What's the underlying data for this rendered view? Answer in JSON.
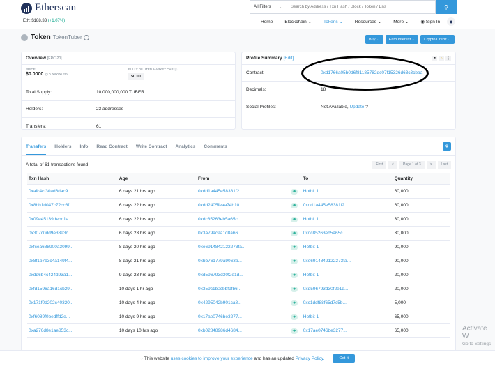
{
  "header": {
    "logo_text": "Etherscan",
    "eth_price_label": "Eth: $188.33",
    "eth_price_change": "(+1.07%)",
    "filter_label": "All Filters",
    "search_placeholder": "Search by Address / Txn Hash / Block / Token / Ens",
    "nav": [
      "Home",
      "Blockchain",
      "Tokens",
      "Resources",
      "More",
      "Sign In"
    ]
  },
  "page": {
    "title": "Token",
    "subtitle": "TokenTuber",
    "buttons": [
      "Buy",
      "Earn Interest",
      "Crypto Credit"
    ]
  },
  "overview": {
    "title": "Overview",
    "tag": "[ERC-20]",
    "price_label": "PRICE",
    "price_value": "$0.0000",
    "price_eth": "@ 0.000000 Eth",
    "cap_label": "FULLY DILUTED MARKET CAP",
    "cap_value": "$0.00",
    "rows": [
      {
        "label": "Total Supply:",
        "value": "10,000,000,000 TUBER"
      },
      {
        "label": "Holders:",
        "value": "23 addresses"
      },
      {
        "label": "Transfers:",
        "value": "61"
      }
    ]
  },
  "profile": {
    "title": "Profile Summary",
    "edit": "[Edit]",
    "contract_label": "Contract:",
    "contract_value": "0xd1766a05b0d6f81185782dc07f15326d63c3cbaa",
    "decimals_label": "Decimals:",
    "decimals_value": "18",
    "social_label": "Social Profiles:",
    "social_value": "Not Available,",
    "social_update": "Update",
    "social_q": "?"
  },
  "tabs": [
    "Transfers",
    "Holders",
    "Info",
    "Read Contract",
    "Write Contract",
    "Analytics",
    "Comments"
  ],
  "transfers": {
    "total": "A total of 61 transactions found",
    "pager": [
      "First",
      "<",
      "Page 1 of 3",
      ">",
      "Last"
    ],
    "columns": [
      "Txn Hash",
      "Age",
      "From",
      "",
      "To",
      "Quantity"
    ],
    "rows": [
      {
        "hash": "0xafc4cf30ad6dac9...",
        "age": "6 days 21 hrs ago",
        "from": "0xdd1a445e58381f2...",
        "to": "Hotbit 1",
        "qty": "60,000"
      },
      {
        "hash": "0x8bb1d047c72cc8f...",
        "age": "6 days 22 hrs ago",
        "from": "0xdd2405feaa74b10...",
        "to": "0xdd1a445e58381f2...",
        "qty": "60,000"
      },
      {
        "hash": "0x09e45139debc1a...",
        "age": "6 days 22 hrs ago",
        "from": "0xdc85263eb5a65c...",
        "to": "Hotbit 1",
        "qty": "30,000"
      },
      {
        "hash": "0x307c0dd9e3393c...",
        "age": "6 days 23 hrs ago",
        "from": "0x3a79ac9a1d8a66...",
        "to": "0xdc85263eb5a65c...",
        "qty": "30,000"
      },
      {
        "hash": "0xfcea688900a3099...",
        "age": "8 days 20 hrs ago",
        "from": "0xe6914842122273fa...",
        "to": "Hotbit 1",
        "qty": "90,000"
      },
      {
        "hash": "0x8f1b7b3c4a149f4...",
        "age": "8 days 21 hrs ago",
        "from": "0xbb761779a9063b...",
        "to": "0xe6914842122273fa...",
        "qty": "90,000"
      },
      {
        "hash": "0xdd6b4c424d93a1...",
        "age": "9 days 23 hrs ago",
        "from": "0xd596793d30f2e1d...",
        "to": "Hotbit 1",
        "qty": "20,000"
      },
      {
        "hash": "0xfd1596a16d1cb29...",
        "age": "10 days 1 hr ago",
        "from": "0x359c1b0cbbf9fb6...",
        "to": "0xd596793d30f2e1d...",
        "qty": "20,000"
      },
      {
        "hash": "0x171f0d202c40320...",
        "age": "10 days 4 hrs ago",
        "from": "0x4295042b901ca8...",
        "to": "0xc1ddf88f65d7c5b...",
        "qty": "5,000"
      },
      {
        "hash": "0xf6089f0bedffd2e...",
        "age": "10 days 9 hrs ago",
        "from": "0x17ae0746be3277...",
        "to": "Hotbit 1",
        "qty": "65,000"
      },
      {
        "hash": "0xa276d8e1ae853c...",
        "age": "10 days 10 hrs ago",
        "from": "0xb02848986d4684...",
        "to": "0x17ae0746be3277...",
        "qty": "65,000"
      }
    ]
  },
  "cookie": {
    "text1": "This website",
    "link1": "uses cookies to improve your experience",
    "text2": "and has an updated",
    "link2": "Privacy Policy.",
    "button": "Got It"
  },
  "watermark": {
    "line1": "Activate W",
    "line2": "Go to Settings"
  },
  "colors": {
    "accent": "#3498db",
    "brand": "#21325b",
    "success": "#00a186"
  }
}
